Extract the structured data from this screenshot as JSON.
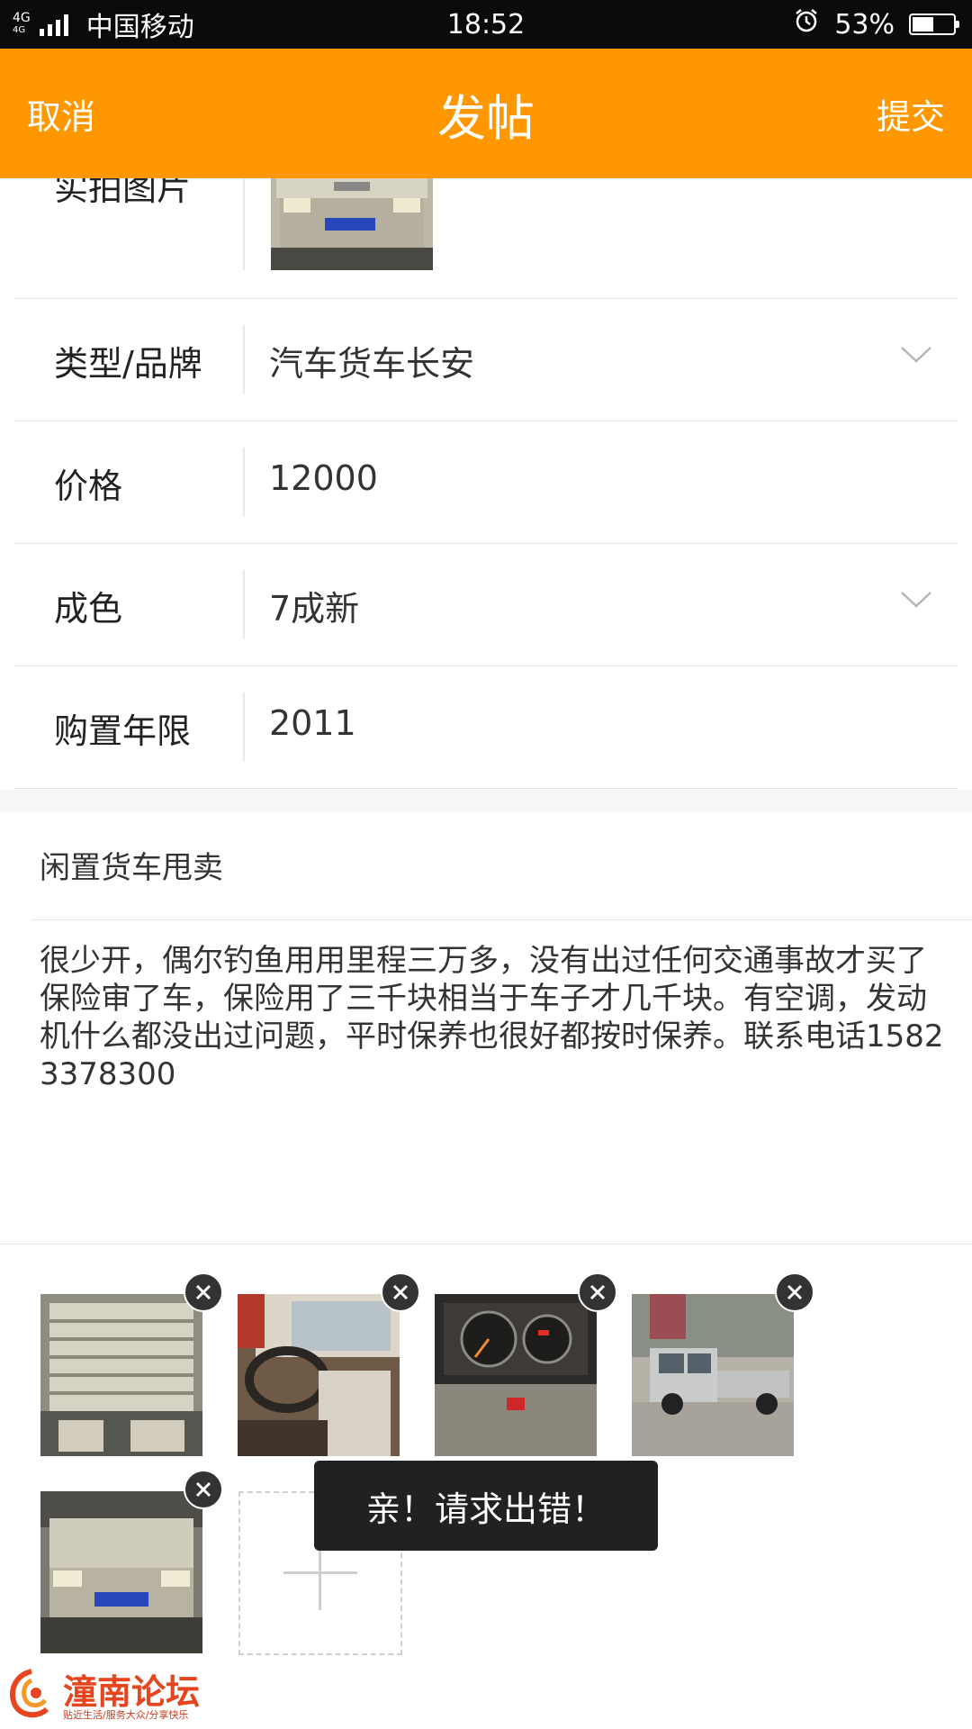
{
  "status_bar": {
    "network_top": "4G",
    "network_bottom": "4G",
    "carrier": "中国移动",
    "time": "18:52",
    "battery_percent": "53%",
    "battery_level": 0.53,
    "icons": [
      "signal-icon",
      "alarm-icon",
      "battery-icon"
    ]
  },
  "app_bar": {
    "cancel_label": "取消",
    "title": "发帖",
    "submit_label": "提交",
    "color": "#ff9800"
  },
  "form": {
    "photo_row_label": "实拍图片",
    "rows": [
      {
        "label": "类型/品牌",
        "value": "汽车货车长安",
        "has_dropdown": true
      },
      {
        "label": "价格",
        "value": "12000",
        "has_dropdown": false
      },
      {
        "label": "成色",
        "value": "7成新",
        "has_dropdown": true
      },
      {
        "label": "购置年限",
        "value": "2011",
        "has_dropdown": false
      }
    ]
  },
  "post": {
    "title": "闲置货车甩卖",
    "body": "很少开，偶尔钓鱼用用里程三万多，没有出过任何交通事故才买了保险审了车，保险用了三千块相当于车子才几千块。有空调，发动机什么都没出过问题，平时保养也很好都按时保养。联系电话15823378300"
  },
  "images": {
    "count": 5,
    "add_icon": "plus-icon",
    "remove_icon": "close-icon"
  },
  "toast": {
    "message": "亲！请求出错！"
  },
  "watermark": {
    "title": "潼南论坛",
    "subtitle": "贴近生活/服务大众/分享快乐"
  }
}
